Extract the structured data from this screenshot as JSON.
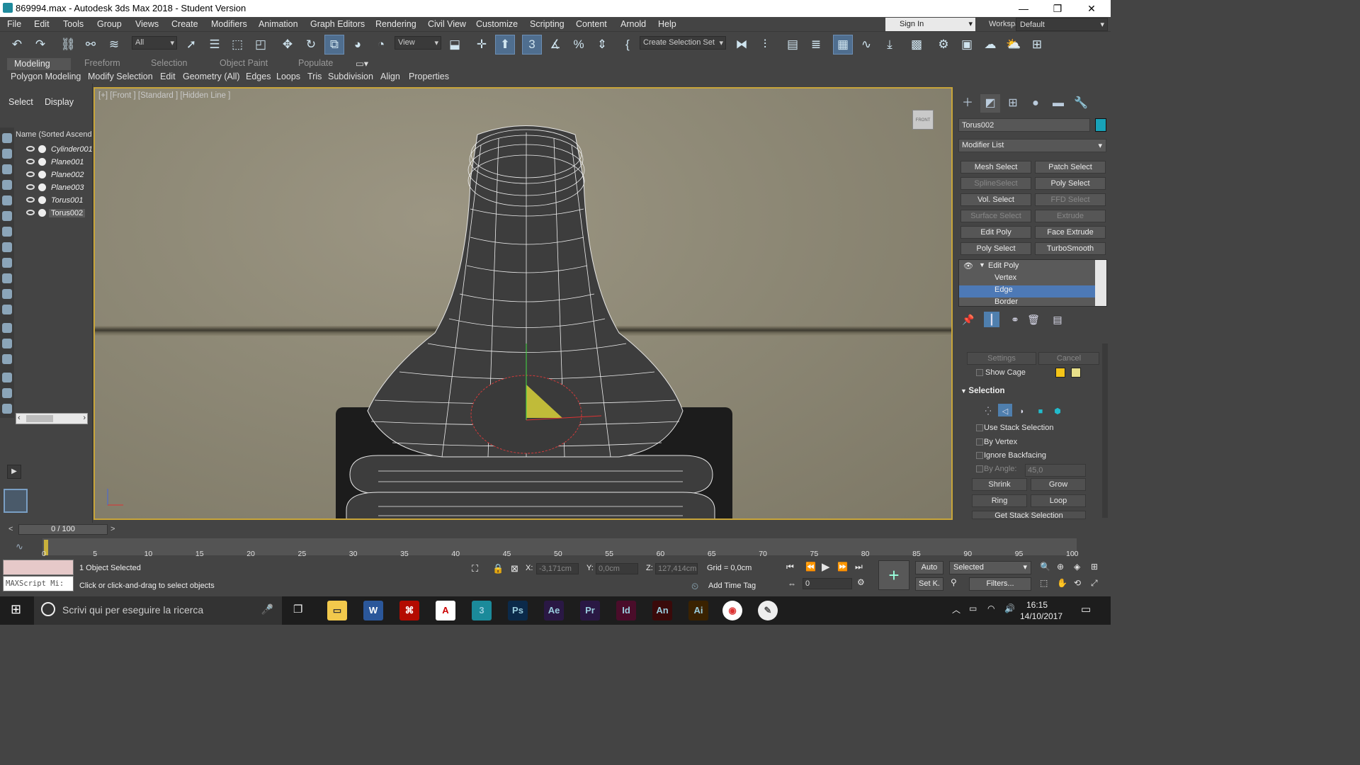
{
  "window": {
    "title": "869994.max - Autodesk 3ds Max 2018 - Student Version",
    "controls": [
      "—",
      "❐",
      "✕"
    ]
  },
  "menu": [
    "File",
    "Edit",
    "Tools",
    "Group",
    "Views",
    "Create",
    "Modifiers",
    "Animation",
    "Graph Editors",
    "Rendering",
    "Civil View",
    "Customize",
    "Scripting",
    "Content",
    "Arnold",
    "Help"
  ],
  "signin": "Sign In",
  "workspaces": {
    "label": "Workspaces:",
    "value": "Default"
  },
  "toolbar": {
    "filter_value": "All",
    "ref_coord": "View",
    "selection_set": "Create Selection Set"
  },
  "ribbon": {
    "tabs": [
      "Modeling",
      "Freeform",
      "Selection",
      "Object Paint",
      "Populate"
    ],
    "subtabs": [
      "Polygon Modeling",
      "Modify Selection",
      "Edit",
      "Geometry (All)",
      "Edges",
      "Loops",
      "Tris",
      "Subdivision",
      "Align",
      "Properties"
    ]
  },
  "explorer": {
    "tabs": [
      "Select",
      "Display"
    ],
    "column_header": "Name (Sorted Ascend",
    "objects": [
      "Cylinder001",
      "Plane001",
      "Plane002",
      "Plane003",
      "Torus001",
      "Torus002"
    ],
    "selected": "Torus002"
  },
  "viewport": {
    "label": "[+] [Front ] [Standard ] [Hidden Line ]",
    "viewcube_label": "FRONT"
  },
  "command_panel": {
    "object_name": "Torus002",
    "object_color": "#18a2b8",
    "modifier_list": "Modifier List",
    "modifier_buttons": [
      {
        "label": "Mesh Select",
        "enabled": true
      },
      {
        "label": "Patch Select",
        "enabled": true
      },
      {
        "label": "SplineSelect",
        "enabled": false
      },
      {
        "label": "Poly Select",
        "enabled": true
      },
      {
        "label": "Vol. Select",
        "enabled": true
      },
      {
        "label": "FFD Select",
        "enabled": false
      },
      {
        "label": "Surface Select",
        "enabled": false
      },
      {
        "label": "Extrude",
        "enabled": false
      },
      {
        "label": "Edit Poly",
        "enabled": true
      },
      {
        "label": "Face Extrude",
        "enabled": true
      },
      {
        "label": "Poly Select",
        "enabled": true
      },
      {
        "label": "TurboSmooth",
        "enabled": true
      }
    ],
    "stack": [
      "Edit Poly",
      "Vertex",
      "Edge",
      "Border"
    ],
    "stack_selected": "Edge",
    "settings": "Settings",
    "cancel": "Cancel",
    "show_cage": "Show Cage",
    "cage_colors": [
      "#f5c518",
      "#e8e08a"
    ],
    "selection_rollout": "Selection",
    "use_stack_selection": "Use Stack Selection",
    "by_vertex": "By Vertex",
    "ignore_backfacing": "Ignore Backfacing",
    "by_angle_label": "By Angle:",
    "by_angle_value": "45,0",
    "shrink": "Shrink",
    "grow": "Grow",
    "ring": "Ring",
    "loop": "Loop",
    "get_stack_selection": "Get Stack Selection"
  },
  "timeline": {
    "frame": "0 / 100",
    "ticks": [
      "0",
      "5",
      "10",
      "15",
      "20",
      "25",
      "30",
      "35",
      "40",
      "45",
      "50",
      "55",
      "60",
      "65",
      "70",
      "75",
      "80",
      "85",
      "90",
      "95",
      "100"
    ]
  },
  "status": {
    "maxscript": "MAXScript Mi:",
    "selected": "1 Object Selected",
    "prompt": "Click or click-and-drag to select objects",
    "x_label": "X:",
    "x_value": "-3,171cm",
    "y_label": "Y:",
    "y_value": "0,0cm",
    "z_label": "Z:",
    "z_value": "127,414cm",
    "grid": "Grid = 0,0cm",
    "add_time_tag": "Add Time Tag",
    "auto": "Auto",
    "setk": "Set K.",
    "key_mode": "Selected",
    "filters": "Filters...",
    "frame_field": "0"
  },
  "taskbar": {
    "search": "Scrivi qui per eseguire la ricerca",
    "time": "16:15",
    "date": "14/10/2017",
    "apps": [
      {
        "name": "3ds-max",
        "label": "3",
        "color": "#1b8a9a"
      },
      {
        "name": "photoshop",
        "label": "Ps",
        "color": "#0b2a4a"
      },
      {
        "name": "after-effects",
        "label": "Ae",
        "color": "#2a1844"
      },
      {
        "name": "premiere",
        "label": "Pr",
        "color": "#2a1844"
      },
      {
        "name": "indesign",
        "label": "Id",
        "color": "#4a0d2a"
      },
      {
        "name": "animate",
        "label": "An",
        "color": "#3a0a0a"
      },
      {
        "name": "illustrator",
        "label": "Ai",
        "color": "#3a2200"
      }
    ]
  }
}
